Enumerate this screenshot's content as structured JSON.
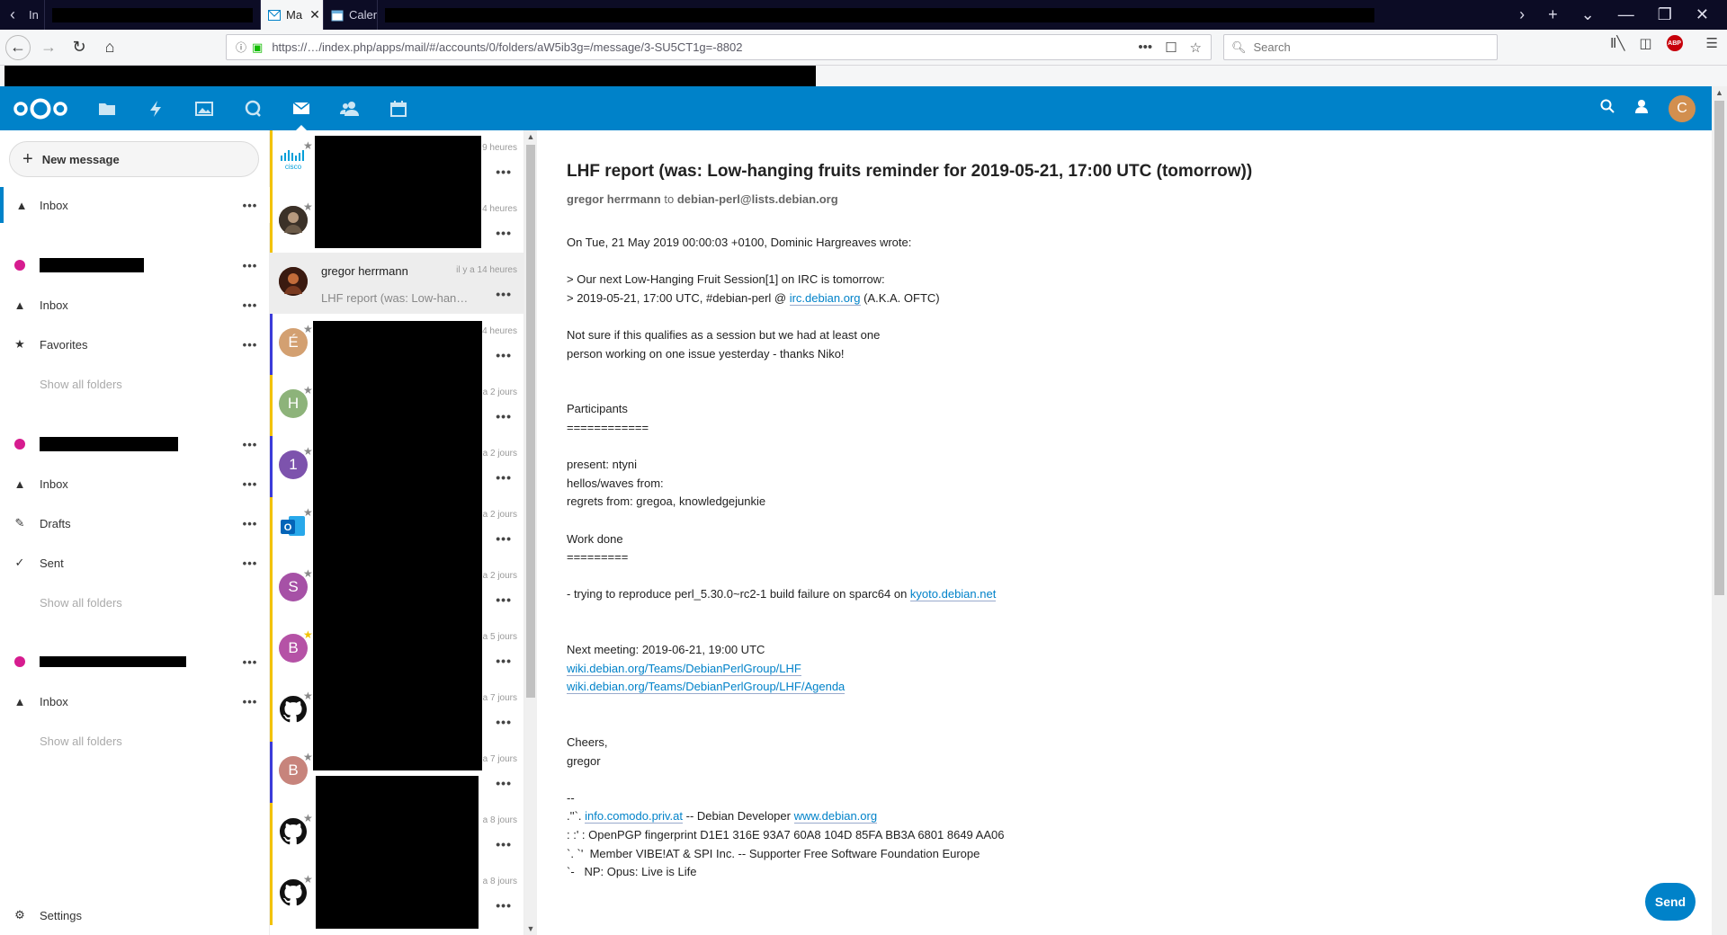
{
  "browser": {
    "tabs": [
      {
        "label": "In",
        "redacted": false
      },
      {
        "label": "",
        "redacted": true
      },
      {
        "label": "Ma",
        "active": true
      },
      {
        "label": "Calen"
      }
    ],
    "url": "https://…/index.php/apps/mail/#/accounts/0/folders/aW5ib3g=/message/3-SU5CT1g=-8802",
    "search_placeholder": "Search",
    "abp_label": "ABP"
  },
  "header": {
    "avatar_letter": "C",
    "apps": [
      "files",
      "activity",
      "photos",
      "talk",
      "mail",
      "contacts",
      "calendar"
    ]
  },
  "nav": {
    "new_message": "New message",
    "accounts": [
      {
        "folders": [
          {
            "label": "Inbox",
            "icon": "inbox-icon",
            "active": true
          }
        ]
      },
      {
        "folders": [
          {
            "label": "Inbox",
            "icon": "inbox-icon"
          },
          {
            "label": "Favorites",
            "icon": "star-icon"
          }
        ],
        "show_all": "Show all folders"
      },
      {
        "folders": [
          {
            "label": "Inbox",
            "icon": "inbox-icon"
          },
          {
            "label": "Drafts",
            "icon": "pencil-icon"
          },
          {
            "label": "Sent",
            "icon": "check-icon"
          }
        ],
        "show_all": "Show all folders"
      },
      {
        "folders": [
          {
            "label": "Inbox",
            "icon": "inbox-icon"
          }
        ],
        "show_all": "Show all folders"
      }
    ],
    "settings": "Settings",
    "account_color": "#d61c8f"
  },
  "list": {
    "messages": [
      {
        "avatar": "cisco",
        "time": "9 heures",
        "redacted": true
      },
      {
        "avatar": "photo",
        "time": "4 heures",
        "redacted": true
      },
      {
        "avatar": "photo",
        "from": "gregor herrmann",
        "subject": "LHF report (was: Low-han…",
        "time": "il y a 14 heures",
        "selected": true
      },
      {
        "avatar": "É",
        "color": "#d3a071",
        "time": "4 heures",
        "redacted": true
      },
      {
        "avatar": "H",
        "color": "#8db37a",
        "time": "a 2 jours",
        "redacted": true
      },
      {
        "avatar": "1",
        "color": "#7d53ad",
        "time": "a 2 jours",
        "redacted": true
      },
      {
        "avatar": "outlook",
        "time": "a 2 jours",
        "redacted": true
      },
      {
        "avatar": "S",
        "color": "#a651a6",
        "time": "a 2 jours",
        "redacted": true
      },
      {
        "avatar": "B",
        "color": "#b552a6",
        "time": "a 5 jours",
        "redacted": true,
        "favorite": true
      },
      {
        "avatar": "github",
        "time": "a 7 jours",
        "redacted": true
      },
      {
        "avatar": "B",
        "color": "#c7847c",
        "time": "a 7 jours",
        "redacted": true
      },
      {
        "avatar": "github",
        "time": "a 8 jours",
        "redacted": true
      },
      {
        "avatar": "github",
        "time": "a 8 jours",
        "redacted": true
      }
    ]
  },
  "message": {
    "subject": "LHF report (was: Low-hanging fruits reminder for 2019-05-21, 17:00 UTC (tomorrow))",
    "from": "gregor herrmann",
    "to_word": "to",
    "to": "debian-perl@lists.debian.org",
    "body": {
      "l1": "On Tue, 21 May 2019 00:00:03 +0100, Dominic Hargreaves wrote:",
      "l2": "> Our next Low-Hanging Fruit Session[1] on IRC is tomorrow:",
      "l3a": "> 2019-05-21, 17:00 UTC, #debian-perl @ ",
      "l3link": "irc.debian.org",
      "l3b": " (A.K.A. OFTC)",
      "l4": "Not sure if this qualifies as a session but we had at least one",
      "l5": "person working on one issue yesterday - thanks Niko!",
      "l6": "Participants",
      "l7": "============",
      "l8": "present: ntyni",
      "l9": "hellos/waves from:",
      "l10": "regrets from: gregoa, knowledgejunkie",
      "l11": "Work done",
      "l12": "=========",
      "l13a": "- trying to reproduce perl_5.30.0~rc2-1 build failure on sparc64 on ",
      "l13link": "kyoto.debian.net",
      "l14": "Next meeting: 2019-06-21, 19:00 UTC",
      "l15link": "wiki.debian.org/Teams/DebianPerlGroup/LHF",
      "l16link": "wiki.debian.org/Teams/DebianPerlGroup/LHF/Agenda",
      "l17": "Cheers,",
      "l18": "gregor",
      "l19": "--",
      "l20a": ".''`. ",
      "l20link1": "info.comodo.priv.at",
      "l20b": " -- Debian Developer ",
      "l20link2": "www.debian.org",
      "l21": ": :' : OpenPGP fingerprint D1E1 316E 93A7 60A8 104D 85FA BB3A 6801 8649 AA06",
      "l22": "`. `'  Member VIBE!AT & SPI Inc. -- Supporter Free Software Foundation Europe",
      "l23": "`-   NP: Opus: Live is Life"
    },
    "send": "Send"
  },
  "colors": {
    "primary": "#0082c9"
  }
}
